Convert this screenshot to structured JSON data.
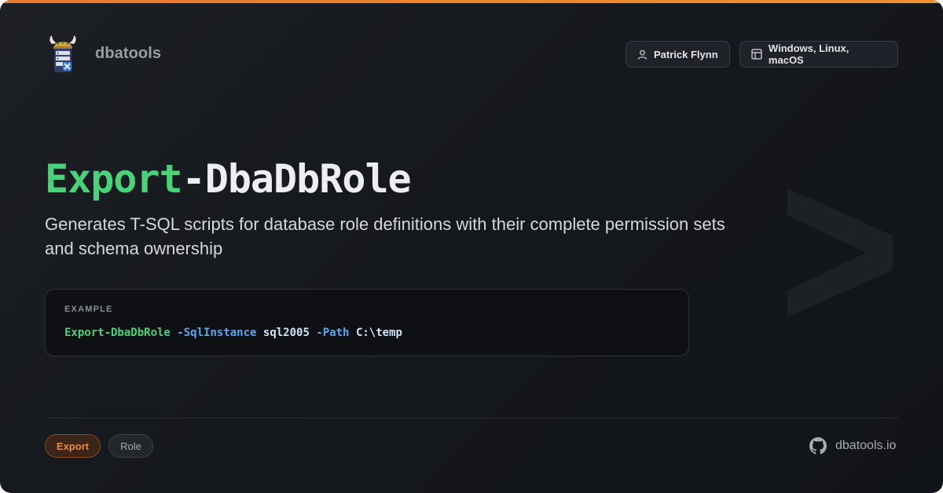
{
  "brand": {
    "name": "dbatools",
    "logo_icon": "viking-server-logo-icon"
  },
  "header": {
    "author": "Patrick Flynn",
    "author_icon": "user-icon",
    "platforms": "Windows, Linux, macOS",
    "platforms_icon": "window-layout-icon"
  },
  "title": {
    "verb": "Export",
    "noun": "-DbaDbRole"
  },
  "description": "Generates T-SQL scripts for database role definitions with their complete permission sets and schema ownership",
  "example": {
    "label": "EXAMPLE",
    "command": "Export-DbaDbRole",
    "param1": "-SqlInstance",
    "value1": "sql2005",
    "param2": "-Path",
    "value2": "C:\\temp"
  },
  "tags": [
    "Export",
    "Role"
  ],
  "footer": {
    "site": "dbatools.io",
    "site_icon": "github-icon"
  },
  "colors": {
    "accent": "#f0902f",
    "verb": "#4ad27a",
    "param": "#5aa7f0",
    "background": "#15181d"
  }
}
